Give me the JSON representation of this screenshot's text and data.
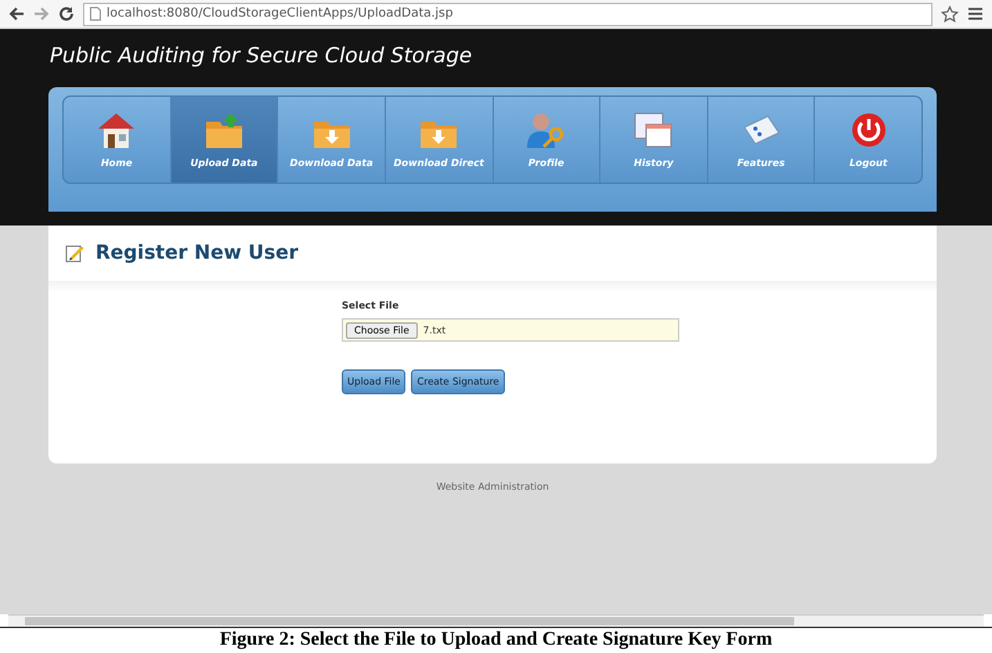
{
  "browser": {
    "url": "localhost:8080/CloudStorageClientApps/UploadData.jsp"
  },
  "site_title": "Public Auditing for Secure Cloud Storage",
  "nav": [
    {
      "label": "Home",
      "selected": false
    },
    {
      "label": "Upload Data",
      "selected": true
    },
    {
      "label": "Download Data",
      "selected": false
    },
    {
      "label": "Download Direct",
      "selected": false
    },
    {
      "label": "Profile",
      "selected": false
    },
    {
      "label": "History",
      "selected": false
    },
    {
      "label": "Features",
      "selected": false
    },
    {
      "label": "Logout",
      "selected": false
    }
  ],
  "page_heading": "Register New User",
  "form": {
    "label": "Select File",
    "choose_button": "Choose File",
    "file_name": "7.txt",
    "buttons": [
      "Upload File",
      "Create Signature"
    ]
  },
  "footer": "Website Administration",
  "caption": "Figure 2: Select the File to Upload and Create Signature Key Form"
}
